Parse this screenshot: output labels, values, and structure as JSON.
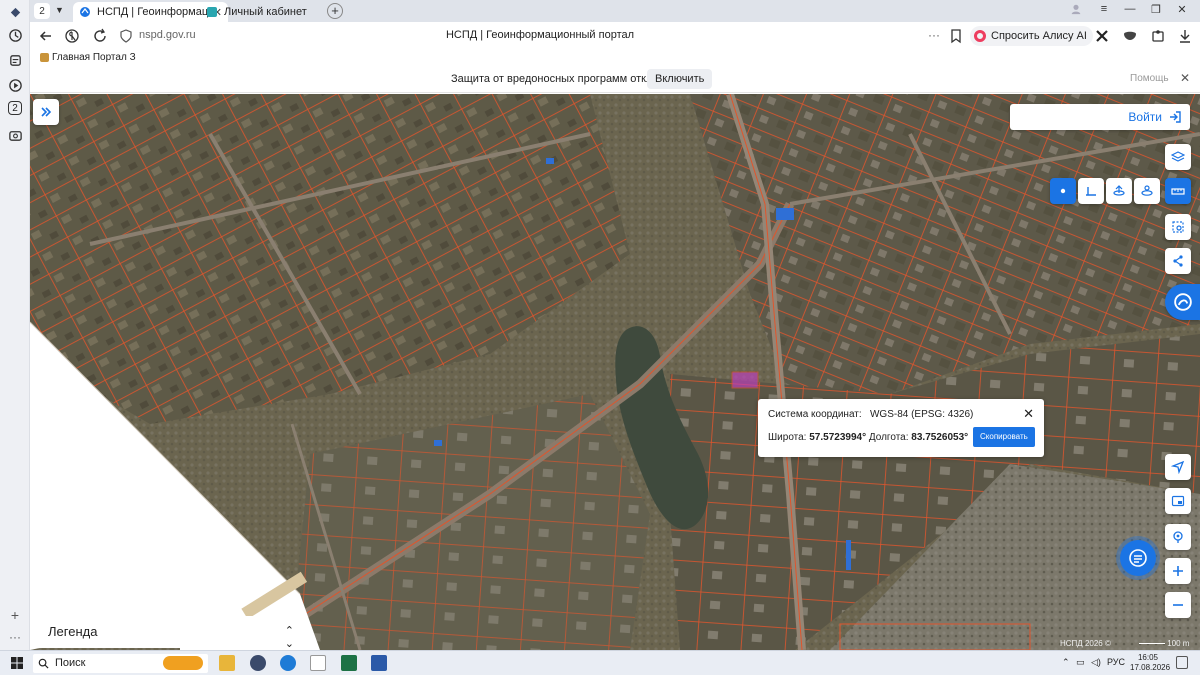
{
  "browser": {
    "tab_count": "2",
    "tabs": [
      {
        "title": "НСПД | Геоинформаци",
        "active": true
      },
      {
        "title": "Личный кабинет",
        "active": false
      }
    ],
    "url": "nspd.gov.ru",
    "page_title": "НСПД | Геоинформационный портал",
    "alice_label": "Спросить Алису AI",
    "bookmark": "Главная Портал З",
    "rail_badge": "2",
    "protection": {
      "message": "Защита от вредоносных программ отключена",
      "enable_label": "Включить",
      "help_label": "Помощь"
    }
  },
  "map": {
    "login_label": "Войти",
    "coordinate_popup": {
      "system_label": "Система координат:",
      "system_value": "WGS-84 (EPSG: 4326)",
      "latitude_label": "Широта:",
      "latitude_value": "57.5723994°",
      "longitude_label": "Долгота:",
      "longitude_value": "83.7526053°",
      "copy_label": "Скопировать"
    },
    "legend_title": "Легенда",
    "attribution": "НСПД 2026 ©",
    "scale_label": "100 m",
    "colors": {
      "accent": "#1b74e4",
      "parcel": "#e0552c",
      "highlight": "#c040c0"
    }
  },
  "taskbar": {
    "search_label": "Поиск",
    "language": "РУС",
    "time": "16:05",
    "date": "17.08.2026"
  }
}
